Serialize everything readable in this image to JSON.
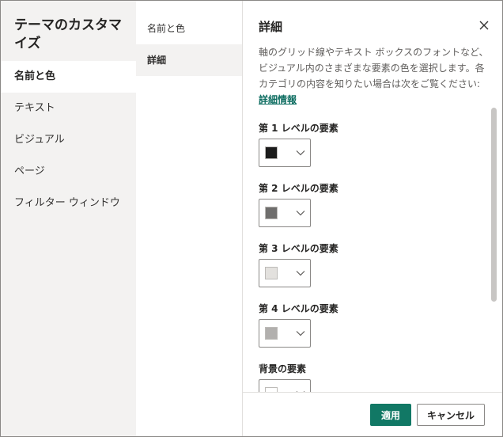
{
  "dialog": {
    "title": "テーマのカスタマイズ",
    "nav": [
      {
        "label": "名前と色",
        "active": true
      },
      {
        "label": "テキスト"
      },
      {
        "label": "ビジュアル"
      },
      {
        "label": "ページ"
      },
      {
        "label": "フィルター ウィンドウ"
      }
    ],
    "subnav": [
      {
        "label": "名前と色"
      },
      {
        "label": "詳細",
        "active": true
      }
    ],
    "content": {
      "title": "詳細",
      "description": "軸のグリッド線やテキスト ボックスのフォントなど、ビジュアル内のさまざまな要素の色を選択します。各カテゴリの内容を知りたい場合は次をご覧ください: ",
      "link": "詳細情報",
      "sections": [
        {
          "label": "第 1 レベルの要素",
          "color": "#1b1b1b"
        },
        {
          "label": "第 2 レベルの要素",
          "color": "#6f6e6d"
        },
        {
          "label": "第 3 レベルの要素",
          "color": "#e3e1de"
        },
        {
          "label": "第 4 レベルの要素",
          "color": "#b2b0ae"
        },
        {
          "label": "背景の要素",
          "color": "#ffffff"
        }
      ]
    },
    "footer": {
      "apply": "適用",
      "cancel": "キャンセル"
    },
    "colors": {
      "accent": "#117865",
      "link": "#0f6e62",
      "nav_bg": "#f3f2f1"
    }
  }
}
